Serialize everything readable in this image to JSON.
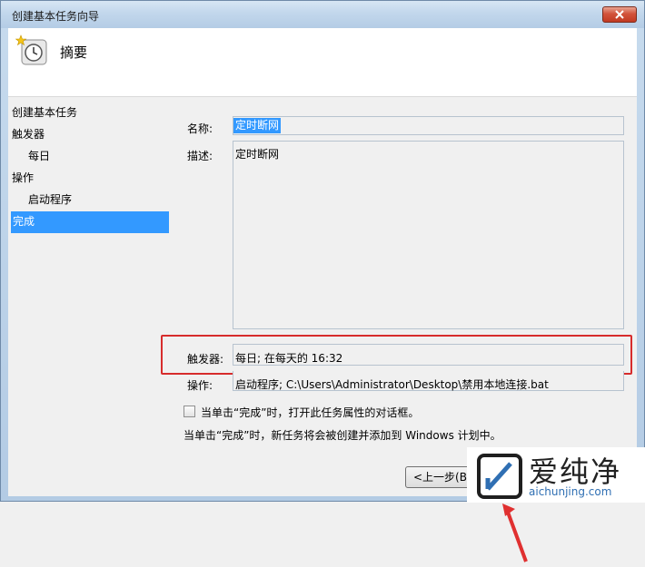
{
  "window": {
    "title": "创建基本任务向导"
  },
  "header": {
    "title": "摘要",
    "icon": "clock-icon"
  },
  "nav": {
    "items": [
      {
        "label": "创建基本任务"
      },
      {
        "label": "触发器"
      },
      {
        "label": "每日"
      },
      {
        "label": "操作"
      },
      {
        "label": "启动程序"
      },
      {
        "label": "完成"
      }
    ]
  },
  "summary": {
    "name_label": "名称:",
    "name_value": "定时断网",
    "desc_label": "描述:",
    "desc_value": "定时断网",
    "trigger_label": "触发器:",
    "trigger_value": "每日; 在每天的 16:32",
    "action_label": "操作:",
    "action_value": "启动程序; C:\\Users\\Administrator\\Desktop\\禁用本地连接.bat"
  },
  "options": {
    "checkbox_label": "当单击“完成”时，打开此任务属性的对话框。",
    "info_text": "当单击“完成”时，新任务将会被创建并添加到 Windows 计划中。"
  },
  "buttons": {
    "back_label": "<上一步(B"
  },
  "watermark": {
    "chinese": "爱纯净",
    "domain": "aichunjing.com"
  },
  "colors": {
    "selection": "#3399ff",
    "highlight_box": "#d72c2c",
    "arrow": "#e03030"
  }
}
